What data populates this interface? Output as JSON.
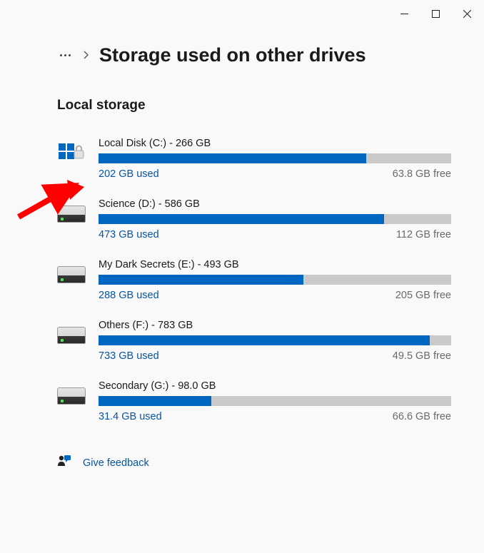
{
  "breadcrumb": {
    "title": "Storage used on other drives"
  },
  "section_title": "Local storage",
  "drives": [
    {
      "title": "Local Disk (C:) - 266 GB",
      "used": "202 GB used",
      "free": "63.8 GB free",
      "pct": 76,
      "icon": "system"
    },
    {
      "title": "Science (D:) - 586 GB",
      "used": "473 GB used",
      "free": "112 GB free",
      "pct": 81,
      "icon": "hdd"
    },
    {
      "title": "My Dark Secrets (E:) - 493 GB",
      "used": "288 GB used",
      "free": "205 GB free",
      "pct": 58,
      "icon": "hdd"
    },
    {
      "title": "Others (F:) - 783 GB",
      "used": "733 GB used",
      "free": "49.5 GB free",
      "pct": 94,
      "icon": "hdd"
    },
    {
      "title": "Secondary (G:) - 98.0 GB",
      "used": "31.4 GB used",
      "free": "66.6 GB free",
      "pct": 32,
      "icon": "hdd"
    }
  ],
  "feedback_label": "Give feedback",
  "chart_data": [
    {
      "type": "bar",
      "title": "Local Disk (C:)",
      "categories": [
        "Used",
        "Free"
      ],
      "values": [
        202,
        63.8
      ],
      "total": 266,
      "unit": "GB"
    },
    {
      "type": "bar",
      "title": "Science (D:)",
      "categories": [
        "Used",
        "Free"
      ],
      "values": [
        473,
        112
      ],
      "total": 586,
      "unit": "GB"
    },
    {
      "type": "bar",
      "title": "My Dark Secrets (E:)",
      "categories": [
        "Used",
        "Free"
      ],
      "values": [
        288,
        205
      ],
      "total": 493,
      "unit": "GB"
    },
    {
      "type": "bar",
      "title": "Others (F:)",
      "categories": [
        "Used",
        "Free"
      ],
      "values": [
        733,
        49.5
      ],
      "total": 783,
      "unit": "GB"
    },
    {
      "type": "bar",
      "title": "Secondary (G:)",
      "categories": [
        "Used",
        "Free"
      ],
      "values": [
        31.4,
        66.6
      ],
      "total": 98.0,
      "unit": "GB"
    }
  ]
}
